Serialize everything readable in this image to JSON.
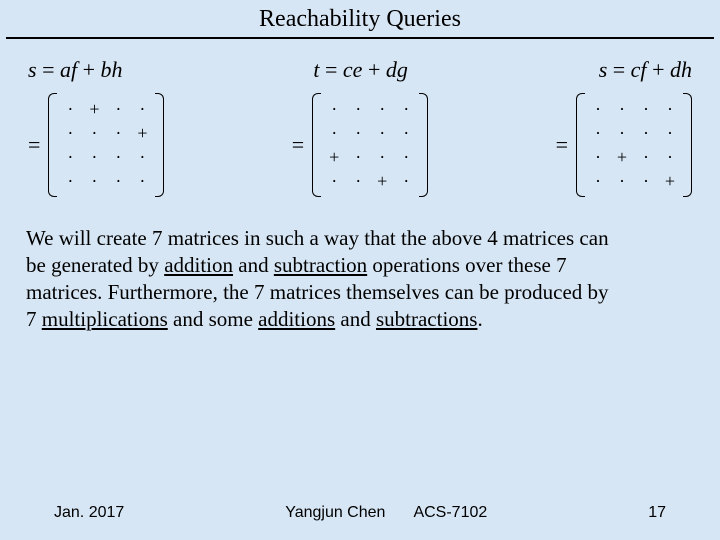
{
  "title": "Reachability Queries",
  "equations": {
    "s_label": "s",
    "t_label": "t",
    "s2_label": "s",
    "eq_sign": "=",
    "s_expr_a": "af",
    "s_expr_b": "bh",
    "t_expr_a": "ce",
    "t_expr_b": "dg",
    "s2_expr_a": "cf",
    "s2_expr_b": "dh",
    "plus": "+"
  },
  "sym": {
    "dot": "·",
    "plus": "+"
  },
  "matrix1": [
    [
      "·",
      "+",
      "·",
      "·"
    ],
    [
      "·",
      "·",
      "·",
      "+"
    ],
    [
      "·",
      "·",
      "·",
      "·"
    ],
    [
      "·",
      "·",
      "·",
      "·"
    ]
  ],
  "matrix2": [
    [
      "·",
      "·",
      "·",
      "·"
    ],
    [
      "·",
      "·",
      "·",
      "·"
    ],
    [
      "+",
      "·",
      "·",
      "·"
    ],
    [
      "·",
      "·",
      "+",
      "·"
    ]
  ],
  "matrix3": [
    [
      "·",
      "·",
      "·",
      "·"
    ],
    [
      "·",
      "·",
      "·",
      "·"
    ],
    [
      "·",
      "+",
      "·",
      "·"
    ],
    [
      "·",
      "·",
      "·",
      "+"
    ]
  ],
  "body": {
    "line1a": "We will create 7 matrices in such a way that the above 4 matrices can",
    "line2a": "be generated by ",
    "u_add": "addition",
    "line2b": " and ",
    "u_sub": "subtraction",
    "line2c": " operations over these 7",
    "line3a": "matrices. Furthermore, the 7 matrices themselves can be produced by",
    "line4a": "7 ",
    "u_mul": "multiplications",
    "line4b": " and some ",
    "u_add2": "additions",
    "line4c": " and ",
    "u_sub2": "subtractions",
    "line4d": "."
  },
  "footer": {
    "date": "Jan. 2017",
    "author": "Yangjun Chen",
    "course": "ACS-7102",
    "page": "17"
  }
}
